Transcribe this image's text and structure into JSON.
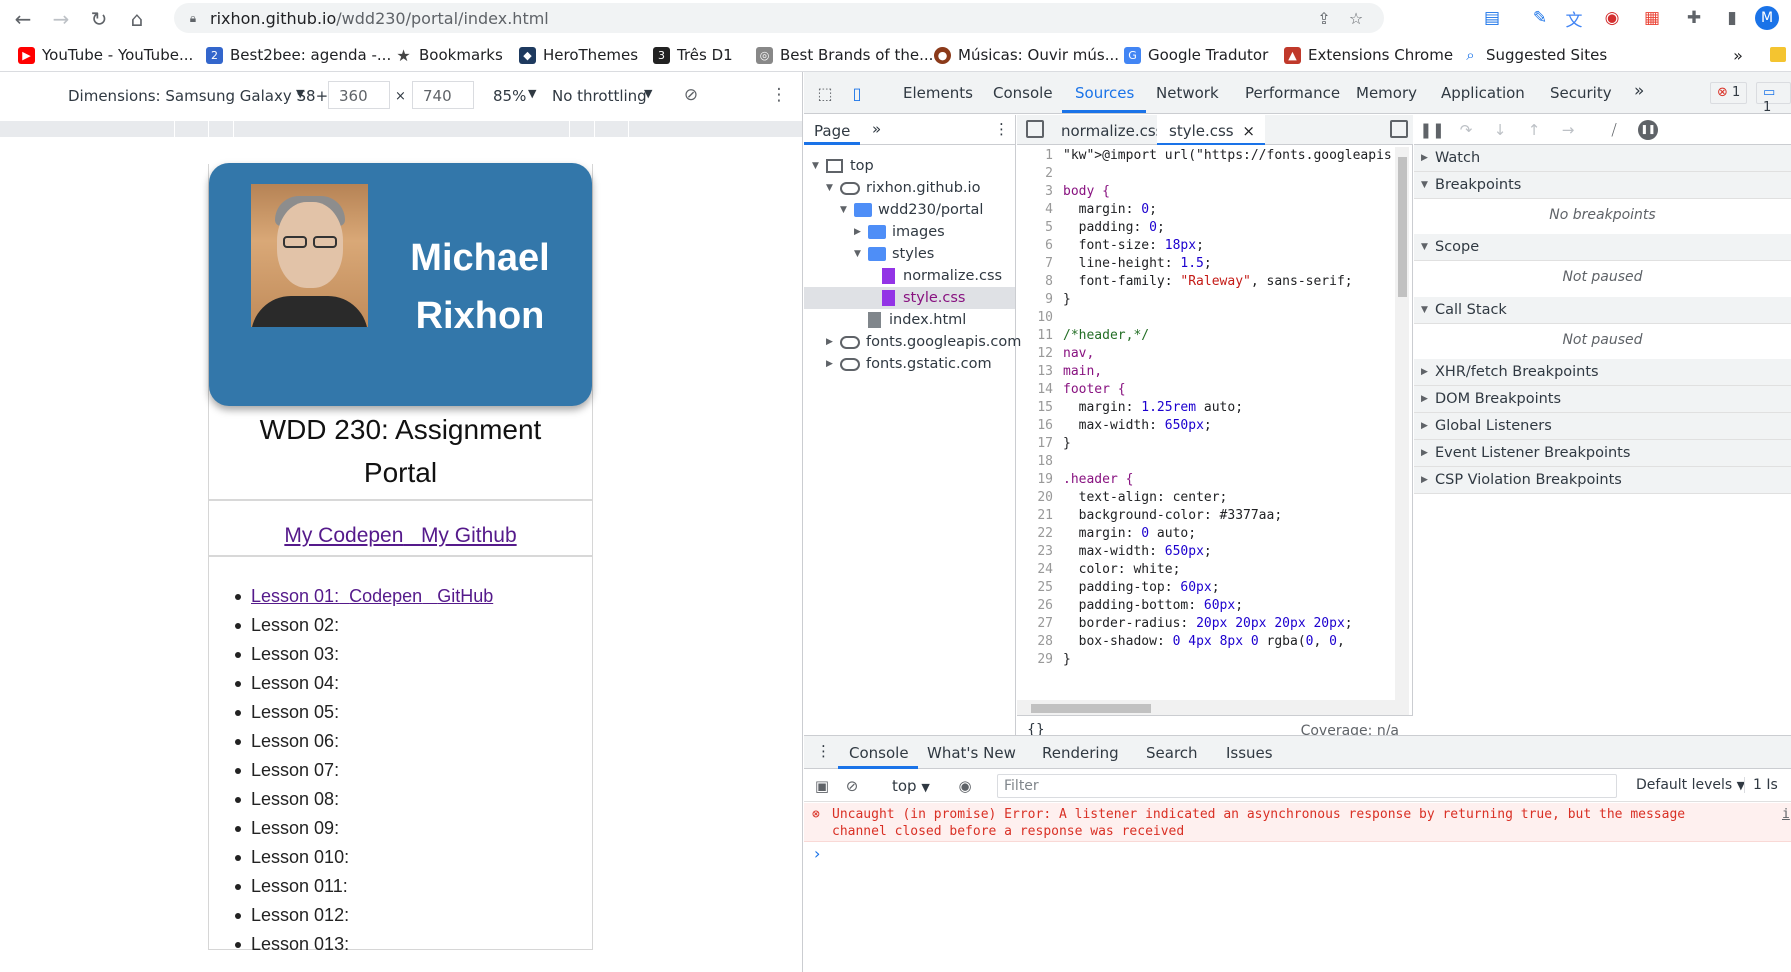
{
  "browser": {
    "url_host": "rixhon.github.io",
    "url_path": "/wdd230/portal/index.html"
  },
  "bookmarks": [
    {
      "label": "YouTube - YouTube...",
      "color": "#ff0000",
      "glyph": "▶"
    },
    {
      "label": "Best2bee: agenda -...",
      "color": "#3366cc",
      "glyph": "2"
    },
    {
      "label": "Bookmarks",
      "color": "#444444",
      "glyph": "★"
    },
    {
      "label": "HeroThemes",
      "color": "#1e3a5f",
      "glyph": "◆"
    },
    {
      "label": "Três D1",
      "color": "#222222",
      "glyph": "3"
    },
    {
      "label": "Best Brands of the...",
      "color": "#888888",
      "glyph": "◎"
    },
    {
      "label": "Músicas: Ouvir mús...",
      "color": "#8b3a1a",
      "glyph": "●"
    },
    {
      "label": "Google Tradutor",
      "color": "#4285f4",
      "glyph": "G"
    },
    {
      "label": "Extensions Chrome",
      "color": "#c0392b",
      "glyph": "▲"
    },
    {
      "label": "Suggested Sites",
      "color": "#1a73e8",
      "glyph": "⌕"
    }
  ],
  "device_toolbar": {
    "dimensions": "Dimensions: Samsung Galaxy S8+",
    "width": "360",
    "height": "740",
    "times": "×",
    "zoom": "85%",
    "throttling": "No throttling"
  },
  "portal": {
    "first_name": "Michael",
    "last_name": "Rixhon",
    "title_line1": "WDD 230: Assignment",
    "title_line2": "Portal",
    "link_codepen": "My Codepen",
    "link_github": "My Github",
    "lesson1_label": "Lesson 01:",
    "lesson1_codepen": "Codepen",
    "lesson1_github": "GitHub",
    "lessons": [
      "Lesson 02:",
      "Lesson 03:",
      "Lesson 04:",
      "Lesson 05:",
      "Lesson 06:",
      "Lesson 07:",
      "Lesson 08:",
      "Lesson 09:",
      "Lesson 010:",
      "Lesson 011:",
      "Lesson 012:",
      "Lesson 013:"
    ]
  },
  "devtools": {
    "tabs": [
      "Elements",
      "Console",
      "Sources",
      "Network",
      "Performance",
      "Memory",
      "Application",
      "Security"
    ],
    "active_tab": "Sources",
    "more": "»",
    "errors": "1",
    "messages": "1",
    "navigator_tab": "Page",
    "tree": {
      "top": "top",
      "host": "rixhon.github.io",
      "folder": "wdd230/portal",
      "images": "images",
      "styles": "styles",
      "normalize": "normalize.css",
      "style": "style.css",
      "index": "index.html",
      "gapis": "fonts.googleapis.com",
      "gstatic": "fonts.gstatic.com"
    },
    "editor_tabs": [
      "normalize.css",
      "style.css"
    ],
    "close": "×",
    "coverage": "Coverage: n/a",
    "pretty": "{}",
    "debugger": {
      "watch": "Watch",
      "breakpoints": "Breakpoints",
      "no_breakpoints": "No breakpoints",
      "scope": "Scope",
      "not_paused": "Not paused",
      "callstack": "Call Stack",
      "callstack_msg": "Not paused",
      "xhr": "XHR/fetch Breakpoints",
      "dom": "DOM Breakpoints",
      "global": "Global Listeners",
      "event": "Event Listener Breakpoints",
      "csp": "CSP Violation Breakpoints"
    },
    "drawer_tabs": [
      "Console",
      "What's New",
      "Rendering",
      "Search",
      "Issues"
    ],
    "context": "top",
    "filter_placeholder": "Filter",
    "levels": "Default levels",
    "issues": "1 Is",
    "error_line1": "Uncaught (in promise) Error: A listener indicated an asynchronous response by returning true, but the message",
    "error_line2": "channel closed before a response was received",
    "error_link": "i",
    "prompt": "›"
  },
  "code_lines": [
    "@import url(\"https://fonts.googleapis.c",
    "",
    "body {",
    "  margin: 0;",
    "  padding: 0;",
    "  font-size: 18px;",
    "  line-height: 1.5;",
    "  font-family: \"Raleway\", sans-serif;",
    "}",
    "",
    "/*header,*/",
    "nav,",
    "main,",
    "footer {",
    "  margin: 1.25rem auto;",
    "  max-width: 650px;",
    "}",
    "",
    ".header {",
    "  text-align: center;",
    "  background-color: #3377aa;",
    "  margin: 0 auto;",
    "  max-width: 650px;",
    "  color: white;",
    "  padding-top: 60px;",
    "  padding-bottom: 60px;",
    "  border-radius: 20px 20px 20px 20px;",
    "  box-shadow: 0 4px 8px 0 rgba(0, 0,",
    "}"
  ],
  "colors": {
    "accent": "#1a73e8",
    "header_blue": "#3377aa",
    "error": "#d93025"
  }
}
